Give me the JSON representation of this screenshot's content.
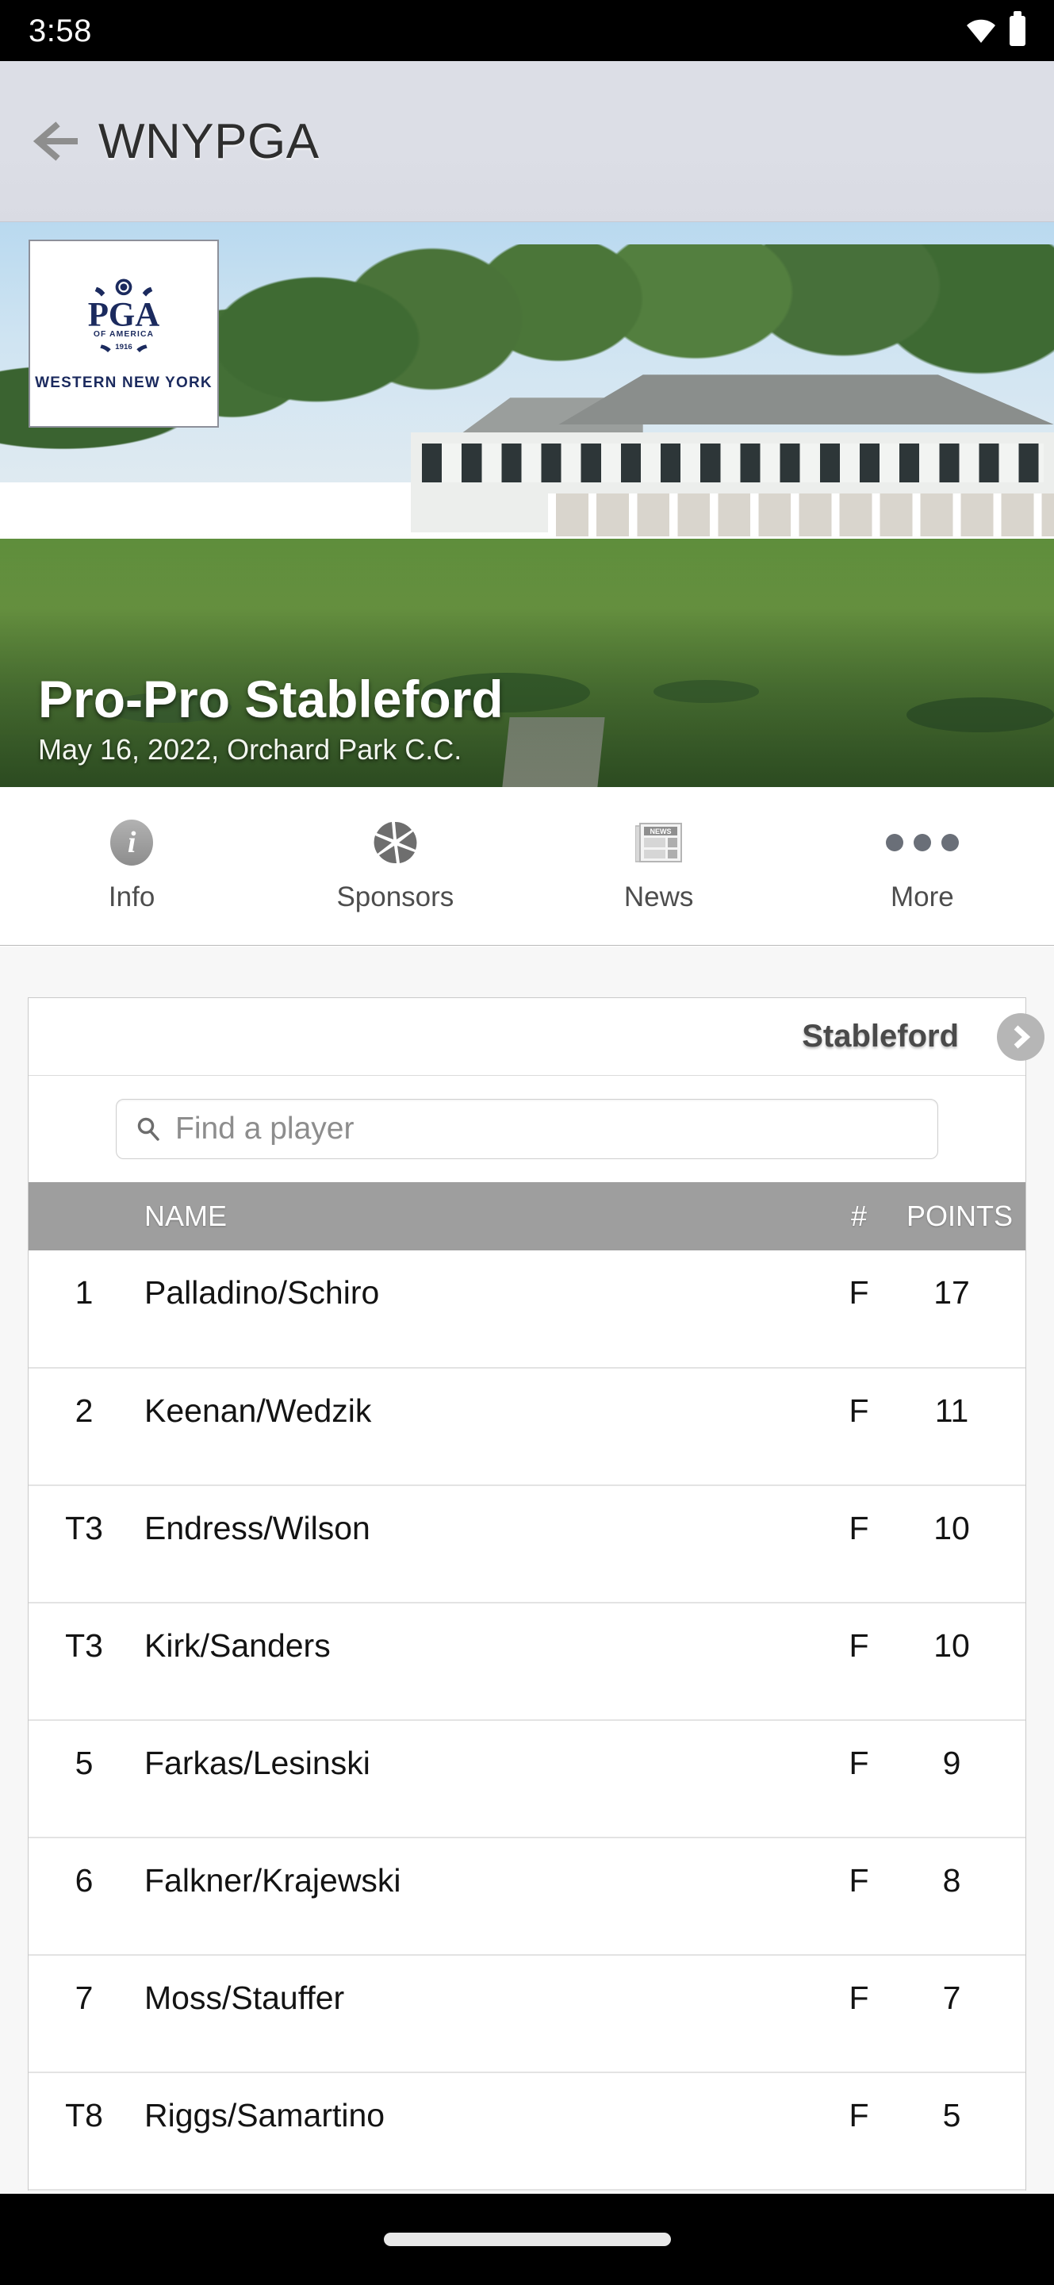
{
  "status_bar": {
    "time": "3:58",
    "wifi_icon": "wifi-icon",
    "battery_icon": "battery-icon"
  },
  "app_bar": {
    "back_icon": "back-arrow-icon",
    "title": "WNYPGA"
  },
  "hero": {
    "logo": {
      "brand": "PGA",
      "brand_sub": "OF AMERICA",
      "year": "1916",
      "section": "WESTERN NEW YORK"
    },
    "event_title": "Pro-Pro Stableford",
    "event_subtitle": "May 16, 2022, Orchard Park C.C."
  },
  "tabs": [
    {
      "label": "Info",
      "icon": "info-circle-icon"
    },
    {
      "label": "Sponsors",
      "icon": "camera-aperture-icon"
    },
    {
      "label": "News",
      "icon": "newspaper-icon",
      "icon_text": "NEWS"
    },
    {
      "label": "More",
      "icon": "ellipsis-icon"
    }
  ],
  "leaderboard": {
    "title": "Stableford",
    "next_icon": "chevron-right-icon",
    "search": {
      "placeholder": "Find a player",
      "value": "",
      "icon": "search-icon"
    },
    "columns": [
      "",
      "NAME",
      "#",
      "POINTS"
    ],
    "rows": [
      {
        "pos": "1",
        "name": "Palladino/Schiro",
        "thru": "F",
        "points": "17"
      },
      {
        "pos": "2",
        "name": "Keenan/Wedzik",
        "thru": "F",
        "points": "11"
      },
      {
        "pos": "T3",
        "name": "Endress/Wilson",
        "thru": "F",
        "points": "10"
      },
      {
        "pos": "T3",
        "name": "Kirk/Sanders",
        "thru": "F",
        "points": "10"
      },
      {
        "pos": "5",
        "name": "Farkas/Lesinski",
        "thru": "F",
        "points": "9"
      },
      {
        "pos": "6",
        "name": "Falkner/Krajewski",
        "thru": "F",
        "points": "8"
      },
      {
        "pos": "7",
        "name": "Moss/Stauffer",
        "thru": "F",
        "points": "7"
      },
      {
        "pos": "T8",
        "name": "Riggs/Samartino",
        "thru": "F",
        "points": "5"
      }
    ]
  },
  "nav_bar": {
    "home_indicator": "home-indicator"
  },
  "colors": {
    "status_bar_bg": "#000000",
    "app_bar_bg": "#dcdee6",
    "table_header_bg": "#9e9e9e",
    "brand_navy": "#1b2a5e",
    "accent_gray": "#b6b6b6"
  }
}
